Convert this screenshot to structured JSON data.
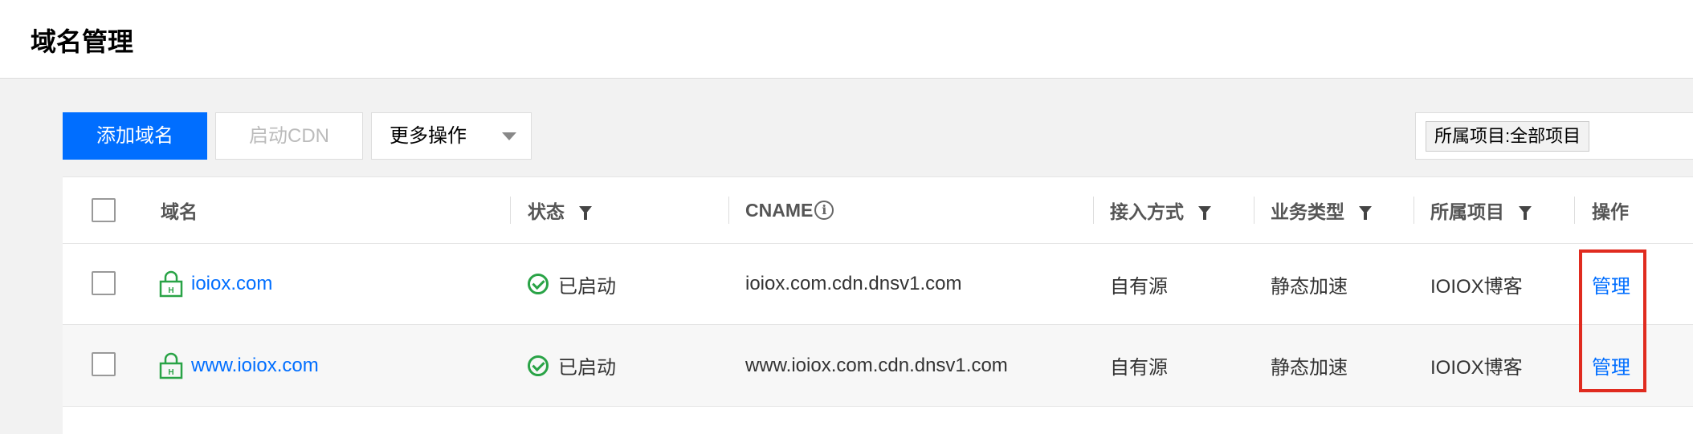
{
  "header": {
    "title": "域名管理"
  },
  "toolbar": {
    "add_domain": "添加域名",
    "enable_cdn": "启动CDN",
    "more_actions": "更多操作",
    "project_filter": "所属项目:全部项目"
  },
  "table": {
    "columns": {
      "domain": "域名",
      "status": "状态",
      "cname": "CNAME",
      "access": "接入方式",
      "business": "业务类型",
      "project": "所属项目",
      "action": "操作"
    },
    "rows": [
      {
        "domain": "ioiox.com",
        "status": "已启动",
        "cname": "ioiox.com.cdn.dnsv1.com",
        "access": "自有源",
        "business": "静态加速",
        "project": "IOIOX博客",
        "action": "管理"
      },
      {
        "domain": "www.ioiox.com",
        "status": "已启动",
        "cname": "www.ioiox.com.cdn.dnsv1.com",
        "access": "自有源",
        "business": "静态加速",
        "project": "IOIOX博客",
        "action": "管理"
      }
    ]
  },
  "colors": {
    "primary": "#006eff",
    "success": "#29a346",
    "highlight": "#e02b1f"
  }
}
